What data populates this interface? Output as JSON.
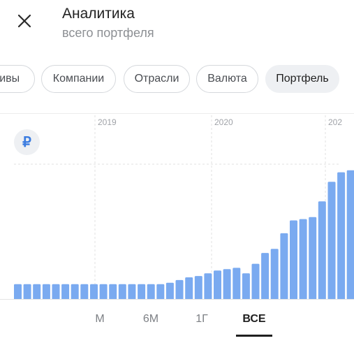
{
  "header": {
    "title": "Аналитика",
    "subtitle": "всего портфеля",
    "close_icon": "close-icon"
  },
  "filters": [
    {
      "label": "тивы",
      "selected": false
    },
    {
      "label": "Компании",
      "selected": false
    },
    {
      "label": "Отрасли",
      "selected": false
    },
    {
      "label": "Валюта",
      "selected": false
    },
    {
      "label": "Портфель",
      "selected": true
    }
  ],
  "currency_symbol": "₽",
  "periods": [
    {
      "label": "М",
      "active": false
    },
    {
      "label": "6М",
      "active": false
    },
    {
      "label": "1Г",
      "active": false
    },
    {
      "label": "ВСЕ",
      "active": true
    }
  ],
  "colors": {
    "bar": "#7aaaf0",
    "accent": "#3b7ce0",
    "grid": "#e2e2e2"
  },
  "chart_data": {
    "type": "bar",
    "year_labels": [
      "2019",
      "2020",
      "202"
    ],
    "ylim": [
      0,
      100
    ],
    "values": [
      11.5,
      11.5,
      11.5,
      11.5,
      11.5,
      11.5,
      11.5,
      11.5,
      11.5,
      11.5,
      11.5,
      11.5,
      11.5,
      11.5,
      11.5,
      11.5,
      12.5,
      14.5,
      16.5,
      17.5,
      19.5,
      21.5,
      22.5,
      23.5,
      19.5,
      26.5,
      34.5,
      37.5,
      49,
      58.5,
      59.5,
      61,
      72.5,
      87,
      94,
      95.5
    ],
    "grid": true
  }
}
